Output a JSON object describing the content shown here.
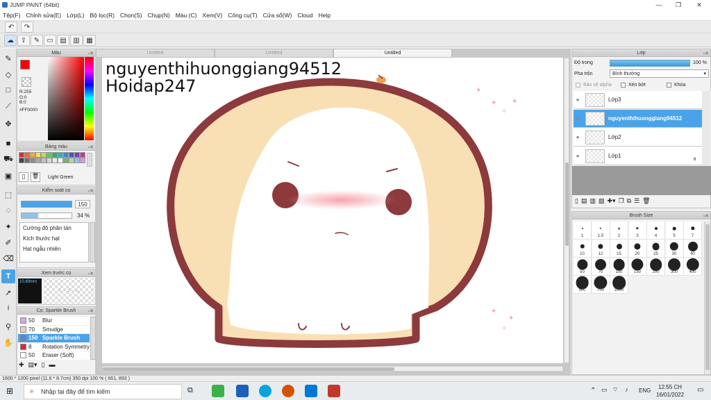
{
  "window": {
    "title": "JUMP PAINT (64bit)"
  },
  "menu": [
    "Tệp(F)",
    "Chỉnh sửa(E)",
    "Lớp(L)",
    "Bộ lọc(R)",
    "Chọn(S)",
    "Chụp(N)",
    "Màu (C)",
    "Xem(V)",
    "Công cụ(T)",
    "Cửa sổ(W)",
    "Cloud",
    "Help"
  ],
  "color_panel": {
    "title": "Màu",
    "r": "R:255",
    "g": "G:0",
    "b": "B:0",
    "hex": "#FF0000",
    "current": "#ff0000"
  },
  "swatch_panel": {
    "title": "Bảng màu",
    "selected_name": "Light Green",
    "colors": [
      "#e0263a",
      "#f06a2a",
      "#f2a74a",
      "#f7e04d",
      "#bde055",
      "#5ec957",
      "#2fae6b",
      "#2fb2b6",
      "#3c86d8",
      "#4c55c9",
      "#7a3fb8",
      "#c0398f",
      "#444444",
      "#6d6d6d",
      "#8c8c8c",
      "#a9a9a9",
      "#c2c2c2",
      "#d8d8d8",
      "#eaeaea",
      "#ffffff",
      "#7ab36a",
      "#b0d89a",
      "#9ac0e8",
      "#d0a0d0"
    ]
  },
  "brush_ctrl": {
    "title": "Kiểm soát cọ",
    "size": "150",
    "opacity": "34 %",
    "options": [
      "Cường độ phân tán",
      "Kích thước hạt",
      "Hạt ngẫu nhiên"
    ]
  },
  "preview_panel": {
    "title": "Xem trước cọ",
    "size_text": "10.89mm"
  },
  "brush_list": {
    "title": "Cọ: Sparkle Brush",
    "items": [
      {
        "size": "50",
        "name": "Blur",
        "color": "#d6a8e0"
      },
      {
        "size": "70",
        "name": "Smudge",
        "color": "#f2c7c7"
      },
      {
        "size": "150",
        "name": "Sparkle Brush",
        "color": "#4b8ad8",
        "selected": true
      },
      {
        "size": "8",
        "name": "Rotation Symmetry",
        "color": "#e0263a"
      },
      {
        "size": "50",
        "name": "Eraser (Soft)",
        "color": "#ffffff"
      }
    ]
  },
  "tabs": [
    "Untitled",
    "Untitled",
    "Untitled"
  ],
  "canvas": {
    "line1": "nguyenthihuonggiang94512",
    "line2": "Hoidap247"
  },
  "layer_panel": {
    "title": "Lớp",
    "opacity_label": "Độ trong",
    "opacity_value": "100 %",
    "blend_label": "Pha trộn",
    "blend_value": "Bình thường",
    "lock_alpha": "Bảo vệ alpha",
    "clip": "Xén bớt",
    "lock": "Khóa",
    "layers": [
      {
        "name": "Lớp3",
        "selected": false
      },
      {
        "name": "nguyenthihuonggiang94512",
        "selected": true
      },
      {
        "name": "Lớp2",
        "selected": false
      },
      {
        "name": "Lớp1",
        "selected": false
      }
    ],
    "badge": "8"
  },
  "brush_size": {
    "title": "Brush Size",
    "sizes": [
      "1",
      "1.5",
      "2",
      "3",
      "4",
      "5",
      "7",
      "10",
      "12",
      "15",
      "20",
      "25",
      "30",
      "40",
      "50",
      "70",
      "100",
      "150",
      "200",
      "300",
      "400",
      "500",
      "700",
      "1000"
    ]
  },
  "status": {
    "text": "1600 * 1200 pixel   (11.6 * 8.7cm)   350 dpi   100 %   ( 661, 893 )"
  },
  "taskbar": {
    "search_placeholder": "Nhập tại đây để tìm kiếm",
    "lang": "ENG",
    "time": "12:55 CH",
    "date": "16/01/2022"
  }
}
